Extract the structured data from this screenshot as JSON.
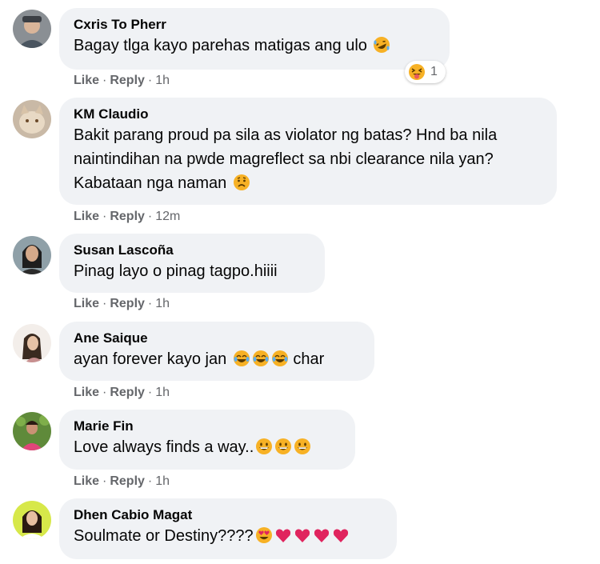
{
  "colors": {
    "bubble": "#f0f2f5",
    "meta_text": "#65676b",
    "emoji_yellow": "#f7b125",
    "heart_red": "#e0245e"
  },
  "actions": {
    "like": "Like",
    "reply": "Reply",
    "separator": "·"
  },
  "comments": [
    {
      "author": "Cxris To Pherr",
      "text": "Bagay tlga kayo parehas matigas ang ulo",
      "emojis": [
        "rofl-emoji"
      ],
      "time": "1h",
      "reaction": {
        "emoji": "squinting-tongue-emoji",
        "count": "1"
      }
    },
    {
      "author": "KM Claudio",
      "text": "Bakit parang proud pa sila as violator ng batas? Hnd ba nila naintindihan na pwde magreflect sa nbi clearance nila yan? Kabataan nga naman",
      "emojis": [
        "worried-face-emoji"
      ],
      "time": "12m"
    },
    {
      "author": "Susan Lascoña",
      "text": "Pinag layo o pinag tagpo.hiiii",
      "emojis": [],
      "time": "1h"
    },
    {
      "author": "Ane Saique",
      "text": "ayan forever kayo jan",
      "emojis": [
        "tears-of-joy-emoji",
        "tears-of-joy-emoji",
        "tears-of-joy-emoji"
      ],
      "text_after": "char",
      "time": "1h"
    },
    {
      "author": "Marie Fin",
      "text": "Love always finds a way..",
      "emojis": [
        "grinning-face-emoji",
        "grinning-face-emoji",
        "grinning-face-emoji"
      ],
      "time": "1h"
    },
    {
      "author": "Dhen Cabio Magat",
      "text": "Soulmate or Destiny????",
      "emojis": [
        "heart-eyes-emoji",
        "red-heart-emoji",
        "red-heart-emoji",
        "red-heart-emoji",
        "red-heart-emoji"
      ]
    }
  ]
}
